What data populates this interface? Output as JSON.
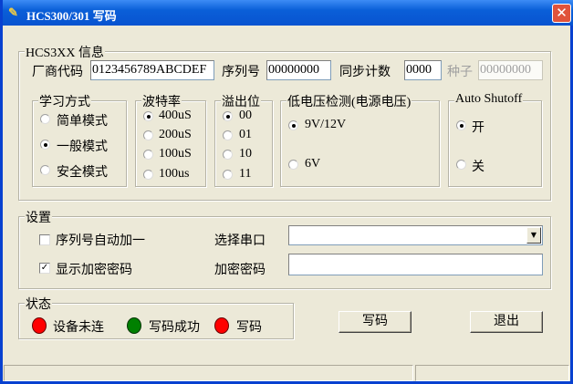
{
  "window": {
    "title": "HCS300/301 写码",
    "close": "✕"
  },
  "info": {
    "legend": "HCS3XX 信息",
    "vendor_label": "厂商代码",
    "vendor_value": "0123456789ABCDEF",
    "serial_label": "序列号",
    "serial_value": "00000000",
    "sync_label": "同步计数",
    "sync_value": "0000",
    "seed_label": "种子",
    "seed_value": "00000000"
  },
  "learn": {
    "legend": "学习方式",
    "options": [
      "简单模式",
      "一般模式",
      "安全模式"
    ],
    "selected": 1
  },
  "baud": {
    "legend": "波特率",
    "options": [
      "400uS",
      "200uS",
      "100uS",
      "100us"
    ],
    "selected": 0
  },
  "overflow": {
    "legend": "溢出位",
    "options": [
      "00",
      "01",
      "10",
      "11"
    ],
    "selected": 0
  },
  "lowvolt": {
    "legend": "低电压检测(电源电压)",
    "options": [
      "9V/12V",
      "6V"
    ],
    "selected": 0
  },
  "autoshutoff": {
    "legend": "Auto Shutoff",
    "options": [
      "开",
      "关"
    ],
    "selected": 0
  },
  "settings": {
    "legend": "设置",
    "serial_auto_inc": "序列号自动加一",
    "serial_auto_inc_checked": false,
    "show_key": "显示加密密码",
    "show_key_checked": true,
    "port_label": "选择串口",
    "port_value": "",
    "key_label": "加密密码",
    "key_value": ""
  },
  "status": {
    "legend": "状态",
    "indicators": [
      {
        "label": "设备未连",
        "color": "#ff0000"
      },
      {
        "label": "写码成功",
        "color": "#008000"
      },
      {
        "label": "写码",
        "color": "#ff0000"
      }
    ]
  },
  "buttons": {
    "write": "写码",
    "exit": "退出"
  },
  "statusbar": [
    "",
    ""
  ]
}
